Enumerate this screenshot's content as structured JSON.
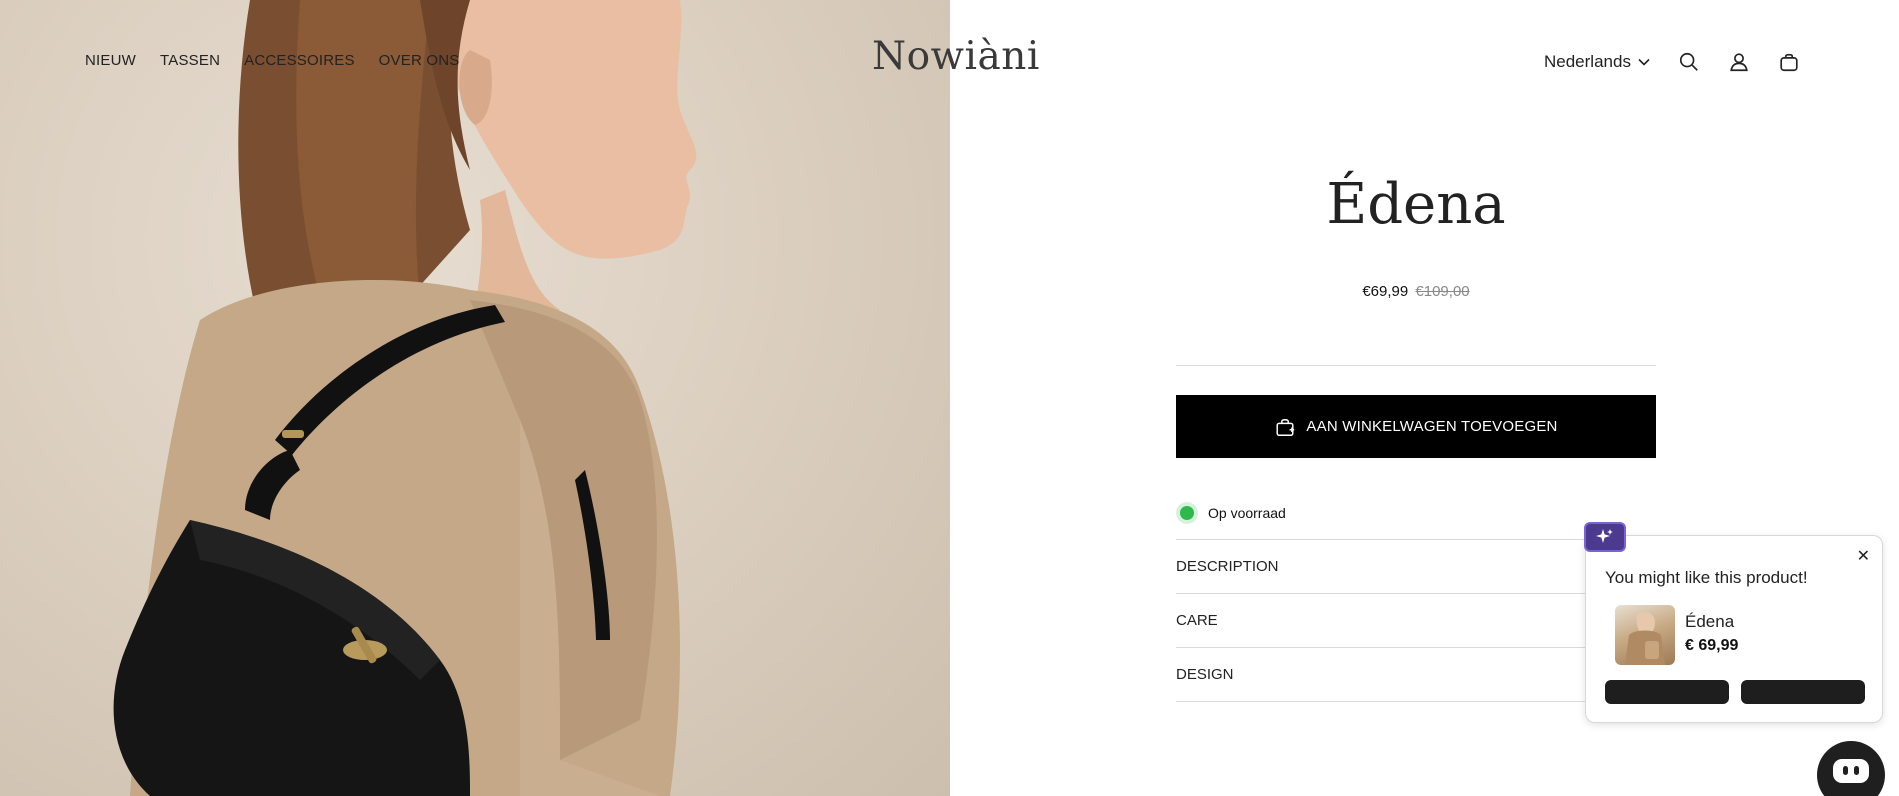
{
  "header": {
    "logo": "Nowiàni",
    "nav": [
      "NIEUW",
      "TASSEN",
      "ACCESSOIRES",
      "OVER ONS"
    ],
    "language": "Nederlands",
    "icons": [
      "search-icon",
      "account-icon",
      "cart-icon"
    ]
  },
  "hero": {
    "image": "model-with-black-shoulder-bag"
  },
  "product": {
    "title": "Édena",
    "price": "€69,99",
    "compare_price": "€109,00",
    "add_to_cart": "AAN WINKELWAGEN TOEVOEGEN",
    "stock": "Op voorraad",
    "accordions": [
      "DESCRIPTION",
      "CARE",
      "DESIGN"
    ]
  },
  "popup": {
    "title": "You might like this product!",
    "product_name": "Édena",
    "product_price": "€ 69,99",
    "close": "✕"
  },
  "colors": {
    "accent": "#000000",
    "stock_green": "#2fb94b",
    "badge_purple": "#4b3a8e"
  }
}
